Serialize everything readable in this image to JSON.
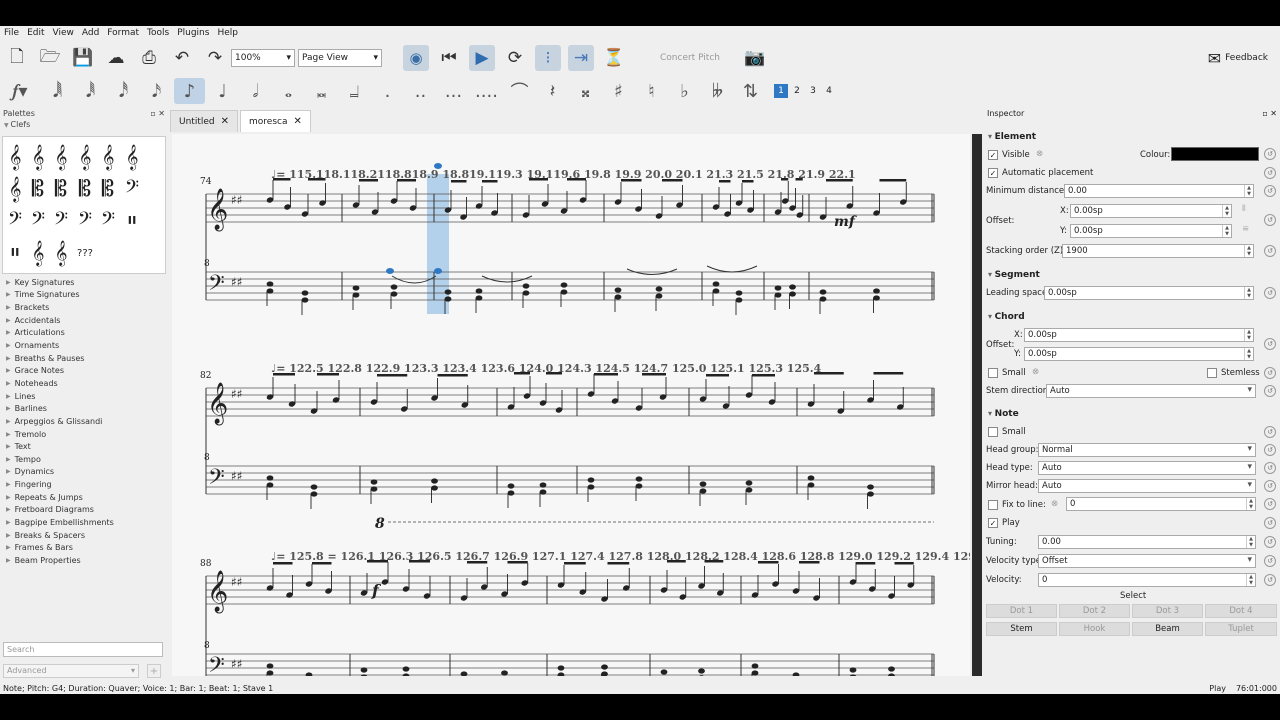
{
  "menu": [
    "File",
    "Edit",
    "View",
    "Add",
    "Format",
    "Tools",
    "Plugins",
    "Help"
  ],
  "toolbar": {
    "zoom": "100%",
    "view_mode": "Page View",
    "concert_pitch": "Concert Pitch",
    "feedback": "Feedback"
  },
  "note_input": {
    "voices": [
      "1",
      "2",
      "3",
      "4"
    ]
  },
  "palettes": {
    "title": "Palettes",
    "open_palette": "Clefs",
    "clef_glyphs": [
      "𝄞",
      "𝄞",
      "𝄞",
      "𝄞",
      "𝄞",
      "𝄞",
      "𝄞",
      "𝄡",
      "𝄡",
      "𝄡",
      "𝄡",
      "𝄢",
      "𝄢",
      "𝄢",
      "𝄢",
      "𝄢",
      "𝄢",
      "𝄥",
      "𝄥",
      "𝄞",
      "𝄞",
      "???"
    ],
    "items": [
      "Key Signatures",
      "Time Signatures",
      "Brackets",
      "Accidentals",
      "Articulations",
      "Ornaments",
      "Breaths & Pauses",
      "Grace Notes",
      "Noteheads",
      "Lines",
      "Barlines",
      "Arpeggios & Glissandi",
      "Tremolo",
      "Text",
      "Tempo",
      "Dynamics",
      "Fingering",
      "Repeats & Jumps",
      "Fretboard Diagrams",
      "Bagpipe Embellishments",
      "Breaks & Spacers",
      "Frames & Bars",
      "Beam Properties"
    ],
    "search_placeholder": "Search",
    "advanced": "Advanced"
  },
  "tabs": [
    {
      "label": "Untitled",
      "selected": false
    },
    {
      "label": "moresca",
      "selected": true
    }
  ],
  "score": {
    "systems": [
      {
        "measure": "74",
        "tempo": "♩= 115.118.118.2118.818.9 18.819.119.3 19.119.6 19.8 19.9 20.0 20.1 21.3 21.5 21.8 21.9 22.1"
      },
      {
        "measure": "82",
        "tempo": "♩= 122.5 122.8 122.9 123.3 123.4 123.6 124.0 124.3 124.5 124.7 125.0 125.1 125.3 125.4"
      },
      {
        "measure": "88",
        "tempo": "♩= 125.8 = 126.1 126.3 126.5 126.7 126.9 127.1 127.4 127.8 128.0 128.2 128.4 128.6 128.8 129.0 129.2 129.4 129.6 129.8 130.1"
      }
    ],
    "dynamics": {
      "mf": "mf",
      "f": "f",
      "octave": "8"
    }
  },
  "inspector": {
    "title": "Inspector",
    "element": {
      "heading": "Element",
      "visible": "Visible",
      "colour": "Colour:",
      "auto_placement": "Automatic placement",
      "min_distance_label": "Minimum distance:",
      "min_distance": "0.00",
      "offset_label": "Offset:",
      "offset_x": "0.00sp",
      "offset_y": "0.00sp",
      "stacking_label": "Stacking order (Z):",
      "stacking": "1900",
      "color_value": "#000000"
    },
    "segment": {
      "heading": "Segment",
      "leading_label": "Leading space:",
      "leading": "0.00sp"
    },
    "chord": {
      "heading": "Chord",
      "offset_label": "Offset:",
      "x": "0.00sp",
      "y": "0.00sp",
      "small": "Small",
      "stemless": "Stemless",
      "stem_dir_label": "Stem direction:",
      "stem_dir": "Auto"
    },
    "note": {
      "heading": "Note",
      "small": "Small",
      "head_group_label": "Head group:",
      "head_group": "Normal",
      "head_type_label": "Head type:",
      "head_type": "Auto",
      "mirror_label": "Mirror head:",
      "mirror": "Auto",
      "fix_line_label": "Fix to line:",
      "fix_line": "0",
      "play": "Play",
      "tuning_label": "Tuning:",
      "tuning": "0.00",
      "vel_type_label": "Velocity type:",
      "vel_type": "Offset",
      "velocity_label": "Velocity:",
      "velocity": "0"
    },
    "select": {
      "heading": "Select",
      "row1": [
        "Dot 1",
        "Dot 2",
        "Dot 3",
        "Dot 4"
      ],
      "row2": [
        "Stem",
        "Hook",
        "Beam",
        "Tuplet"
      ]
    }
  },
  "status": {
    "left": "Note; Pitch: G4; Duration: Quaver; Voice: 1;  Bar: 1; Beat: 1; Stave 1",
    "mode": "Play",
    "time": "76:01:000"
  },
  "colors": {
    "accent": "#2f78c4",
    "selection": "#b3d1ea"
  }
}
